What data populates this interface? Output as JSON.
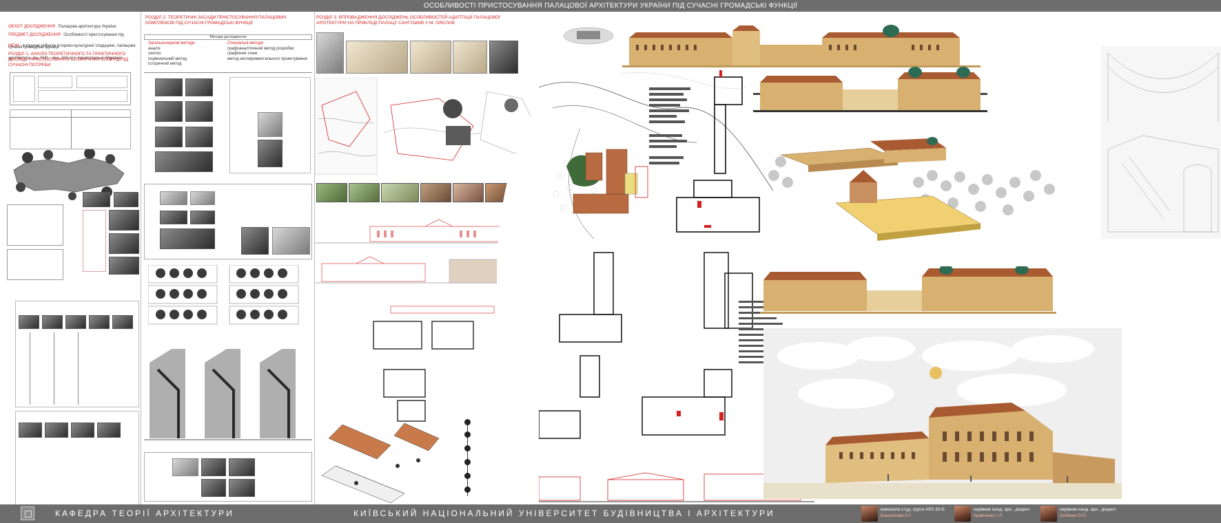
{
  "header": {
    "title": "ОСОБЛИВОСТІ ПРИСТОСУВАННЯ ПАЛАЦОВОЇ АРХІТЕКТУРИ УКРАЇНИ ПІД СУЧАСНІ ГРОМАДСЬКІ ФУНКЦІЇ"
  },
  "footer": {
    "department": "КАФЕДРА ТЕОРІЇ АРХІТЕКТУРИ",
    "university": "КИЇВСЬКИЙ НАЦІОНАЛЬНИЙ УНІВЕРСИТЕТ БУДІВНИЦТВА І АРХІТЕКТУРИ",
    "people": [
      {
        "role": "виконала студ. групи АРХ 83-Б",
        "name": "Башкатова А.Г."
      },
      {
        "role": "керівник канд. арх., доцент",
        "name": "Кравченко І.Л."
      },
      {
        "role": "керівник канд. арх., доцент",
        "name": "Олійник О.П."
      }
    ]
  },
  "section1": {
    "object": "ОБ'ЄКТ ДОСЛІДЖЕННЯ",
    "object_text": "Палацова архітектура України",
    "subject": "ПРЕДМЕТ ДОСЛІДЖЕННЯ",
    "subject_text": "Особливості пристосування під сучасні громадські функції",
    "bounds": "МЕЖІ",
    "bounds_text": "історичні (об'єкти історико-культурної спадщини, палацова архітектура, кін. XVII – поч. XIX ст.), територіальні (Україна)",
    "title": "РОЗДІЛ 1. АНАЛІЗ ТЕОРЕТИЧНОГО ТА ПРАКТИЧНОГО ДОСВІДУ ПРИСТОСУВАННЯ ІСТОРИЧНИХ СПОРУД ПІД СУЧАСНІ ПОТРЕБИ"
  },
  "section2": {
    "title": "РОЗДІЛ 2. ТЕОРЕТИЧНІ ЗАСАДИ ПРИСТОСУВАННЯ ПАЛАЦОВИХ КОМПЛЕКСІВ ПІД СУЧАСНІ ГРОМАДСЬКІ ФУНКЦІЇ",
    "methods_header": "Методи дослідження",
    "general_methods": "Загальнонаукові методи",
    "general_list": "аналіз\nсинтез\nпорівняльний метод\nісторичний метод",
    "special_methods": "Спеціальні методи",
    "special_list": "графоаналітичний метод розробки графічних схем\nметод експериментального проектування"
  },
  "section3": {
    "title": "РОЗДІЛ 3. ВПРОВАДЖЕННЯ ДОСЛІДЖЕНЬ ОСОБЛИВОСТЕЙ АДАПТАЦІЇ ПАЛАЦОВОЇ АРХІТЕКТУРИ НА ПРИКЛАДІ ПАЛАЦУ САНГУШКІВ У М. ІЗЯСЛАВ"
  }
}
